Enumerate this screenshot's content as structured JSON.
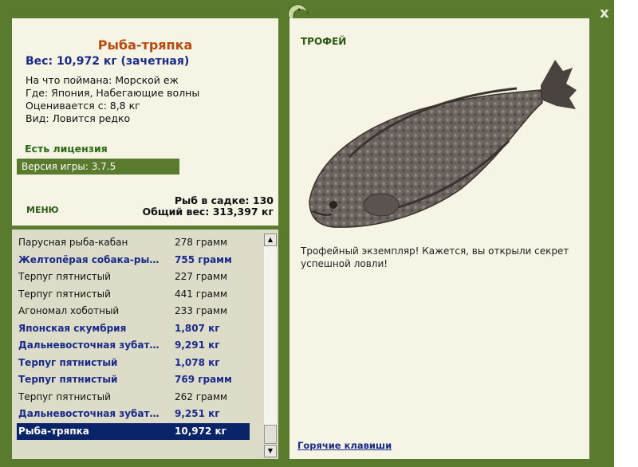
{
  "window": {
    "close_label": "x"
  },
  "fish": {
    "name": "Рыба-тряпка",
    "weight_line": "Вес: 10,972 кг (зачетная)",
    "caught_on": "На что поймана: Морской еж",
    "where": "Где: Япония, Набегающие волны",
    "value": "Оценивается с: 8,8 кг",
    "kind": "Вид: Ловится редко"
  },
  "license": "Есть лицензия",
  "version": "Версия игры: 3.7.5",
  "menu_label": "МЕНЮ",
  "stats": {
    "count": "Рыб в садке: 130",
    "total": "Общий вес: 313,397 кг"
  },
  "catch_list": [
    {
      "name": "Парусная рыба-кабан",
      "weight": "278 грамм",
      "trophy": false,
      "selected": false
    },
    {
      "name": "Желтопёрая собака-рыба",
      "weight": "755 грамм",
      "trophy": true,
      "selected": false
    },
    {
      "name": "Терпуг пятнистый",
      "weight": "227 грамм",
      "trophy": false,
      "selected": false
    },
    {
      "name": "Терпуг пятнистый",
      "weight": "441 грамм",
      "trophy": false,
      "selected": false
    },
    {
      "name": "Агономал хоботный",
      "weight": "233 грамм",
      "trophy": false,
      "selected": false
    },
    {
      "name": "Японская скумбрия",
      "weight": "1,807 кг",
      "trophy": true,
      "selected": false
    },
    {
      "name": "Дальневосточная зубатка",
      "weight": "9,291 кг",
      "trophy": true,
      "selected": false
    },
    {
      "name": "Терпуг пятнистый",
      "weight": "1,078 кг",
      "trophy": true,
      "selected": false
    },
    {
      "name": "Терпуг пятнистый",
      "weight": "769 грамм",
      "trophy": true,
      "selected": false
    },
    {
      "name": "Терпуг пятнистый",
      "weight": "262 грамм",
      "trophy": false,
      "selected": false
    },
    {
      "name": "Дальневосточная зубатка",
      "weight": "9,251 кг",
      "trophy": true,
      "selected": false
    },
    {
      "name": "Рыба-тряпка",
      "weight": "10,972 кг",
      "trophy": true,
      "selected": true
    }
  ],
  "trophy": {
    "heading": "ТРОФЕЙ",
    "text": "Трофейный экземпляр! Кажется, вы открыли секрет успешной ловли!"
  },
  "hotkeys_label": "Горячие клавиши",
  "colors": {
    "frame": "#5a7a2e",
    "panel": "#f6f4e5",
    "trophy_text": "#1a2a8a",
    "selected_row": "#0a246a",
    "fish_title": "#b84a10"
  },
  "icons": {
    "logo": "lizard-logo-icon",
    "close": "close-icon"
  }
}
